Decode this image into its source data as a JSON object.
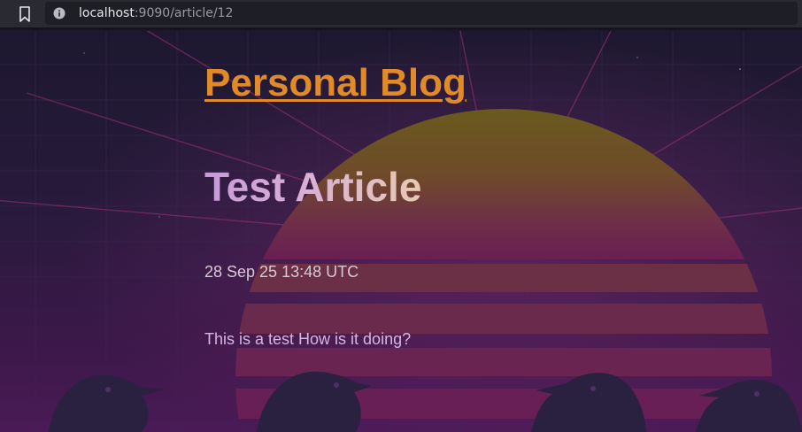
{
  "browser": {
    "url_host": "localhost",
    "url_rest": ":9090/article/12",
    "icons": [
      "bookmark-icon",
      "site-info-icon"
    ]
  },
  "blog": {
    "site_title": "Personal Blog"
  },
  "article": {
    "title": "Test Article",
    "date": "28 Sep 25 13:48 UTC",
    "body": "This is a test How is it doing?"
  },
  "theme": {
    "accent": "#e08a28",
    "sun": "#6b5a1c",
    "background": "#1d1830"
  }
}
